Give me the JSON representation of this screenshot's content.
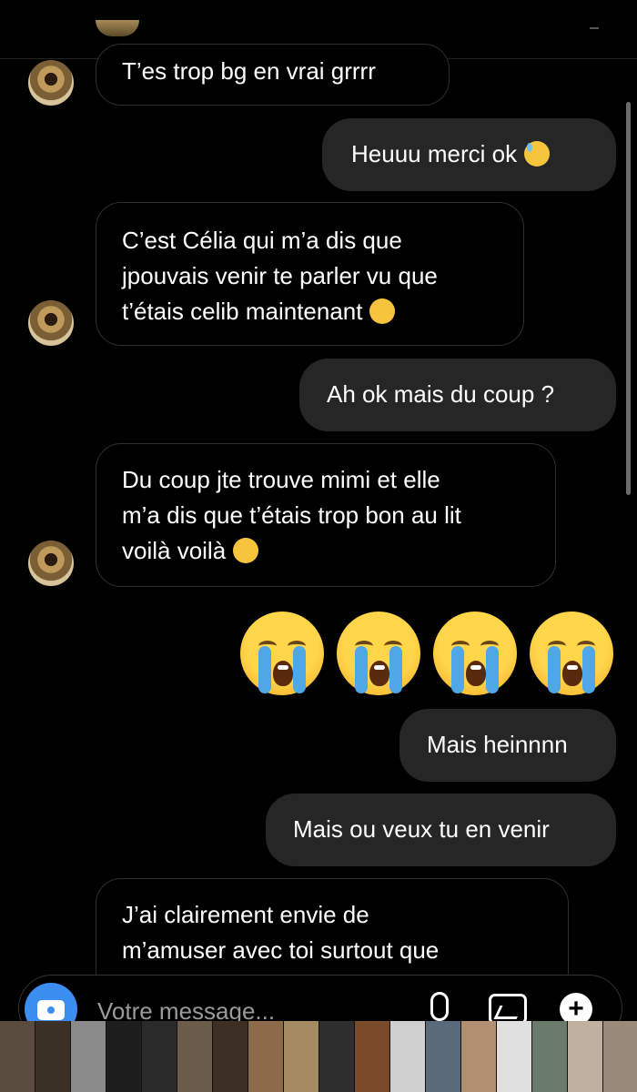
{
  "messages": [
    {
      "id": "m1",
      "side": "in",
      "text": "T’es trop bg en vrai grrrr"
    },
    {
      "id": "m2",
      "side": "out",
      "text": "Heuuu merci ok",
      "emoji": "sweat-smile-emoji"
    },
    {
      "id": "m3",
      "side": "in",
      "lines": [
        "C’est Célia qui m’a dis que",
        "jpouvais venir te parler vu que",
        "t’étais celib maintenant"
      ],
      "emoji": "relieved-emoji"
    },
    {
      "id": "m4",
      "side": "out",
      "text": "Ah ok mais du coup ?"
    },
    {
      "id": "m5",
      "side": "in",
      "lines": [
        "Du coup jte trouve mimi et elle",
        "m’a dis que t’étais trop bon au lit",
        "voilà voilà"
      ],
      "emoji": "kissing-emoji"
    },
    {
      "id": "m6",
      "side": "out",
      "emoji_count": 4,
      "emoji": "loudly-crying-emoji"
    },
    {
      "id": "m7",
      "side": "out",
      "text": "Mais heinnnn"
    },
    {
      "id": "m8",
      "side": "out",
      "text": "Mais ou veux tu en venir"
    },
    {
      "id": "m9",
      "side": "in",
      "lines": [
        "J’ai clairement envie de",
        "m’amuser avec toi surtout que"
      ]
    }
  ],
  "composer": {
    "placeholder": "Votre message..."
  },
  "colors": {
    "background": "#000000",
    "outgoing_bubble": "#262626",
    "incoming_border": "#2f2f2f",
    "camera_button": "#3b8df0"
  },
  "gallery": {
    "thumbnail_colors": [
      "#5a4b3f",
      "#3a3026",
      "#8a8a8a",
      "#1d1d1d",
      "#2a2a2a",
      "#6a5b4a",
      "#3c2e22",
      "#8b6b4a",
      "#a58b64",
      "#2e2e2e",
      "#7a4a2a",
      "#d0d0d0",
      "#5a6a7a",
      "#b09070",
      "#e0e0e0",
      "#6a7a6a",
      "#c0b0a0",
      "#9a8a7a"
    ]
  }
}
